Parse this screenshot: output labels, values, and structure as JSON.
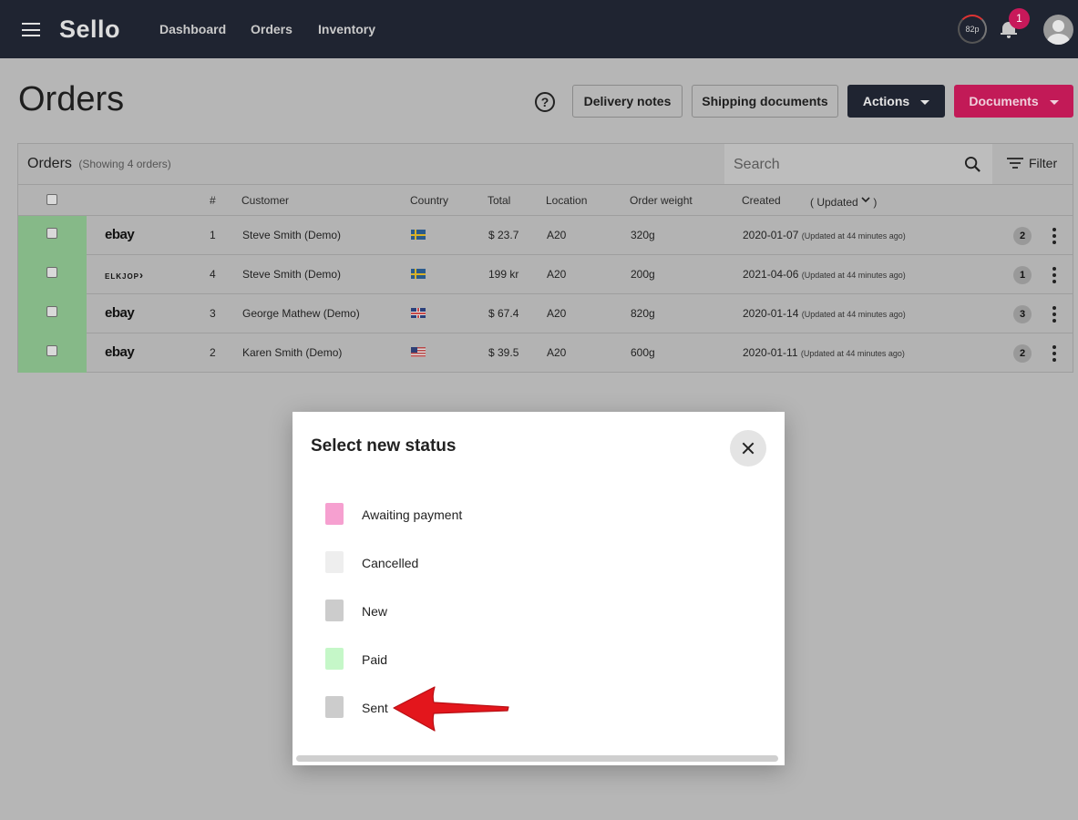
{
  "app": {
    "name": "Sello"
  },
  "nav": {
    "items": [
      "Dashboard",
      "Orders",
      "Inventory"
    ]
  },
  "header": {
    "score": "82p",
    "notifications_count": "1"
  },
  "page": {
    "title": "Orders",
    "help_icon": "question-circle-icon",
    "buttons": {
      "delivery_notes": "Delivery notes",
      "shipping_documents": "Shipping documents",
      "actions": "Actions",
      "documents": "Documents"
    }
  },
  "orders": {
    "title": "Orders",
    "subtitle": "(Showing 4 orders)",
    "search_placeholder": "Search",
    "filter_label": "Filter",
    "columns": {
      "number": "#",
      "customer": "Customer",
      "country": "Country",
      "total": "Total",
      "location": "Location",
      "weight": "Order weight",
      "created": "Created",
      "updated": "( Updated",
      "updated_close": ")"
    },
    "rows": [
      {
        "store": "ebay",
        "number": "1",
        "customer": "Steve Smith (Demo)",
        "country": "SE",
        "total": "$ 23.7",
        "location": "A20",
        "weight": "320g",
        "created": "2020-01-07",
        "updated": "(Updated at 44 minutes ago)",
        "count": "2"
      },
      {
        "store": "ELKJOP",
        "number": "4",
        "customer": "Steve Smith (Demo)",
        "country": "SE",
        "total": "199 kr",
        "location": "A20",
        "weight": "200g",
        "created": "2021-04-06",
        "updated": "(Updated at 44 minutes ago)",
        "count": "1"
      },
      {
        "store": "ebay",
        "number": "3",
        "customer": "George Mathew (Demo)",
        "country": "GB",
        "total": "$ 67.4",
        "location": "A20",
        "weight": "820g",
        "created": "2020-01-14",
        "updated": "(Updated at 44 minutes ago)",
        "count": "3"
      },
      {
        "store": "ebay",
        "number": "2",
        "customer": "Karen Smith (Demo)",
        "country": "US",
        "total": "$ 39.5",
        "location": "A20",
        "weight": "600g",
        "created": "2020-01-11",
        "updated": "(Updated at 44 minutes ago)",
        "count": "2"
      }
    ],
    "status_color": "#86b988"
  },
  "modal": {
    "title": "Select new status",
    "options": [
      {
        "label": "Awaiting payment",
        "color": "#f6a0d0"
      },
      {
        "label": "Cancelled",
        "color": "#eeeeee"
      },
      {
        "label": "New",
        "color": "#cccccc"
      },
      {
        "label": "Paid",
        "color": "#c5f7c8"
      },
      {
        "label": "Sent",
        "color": "#cccccc"
      }
    ],
    "annotation": "red-arrow-pointing-to-sent"
  }
}
